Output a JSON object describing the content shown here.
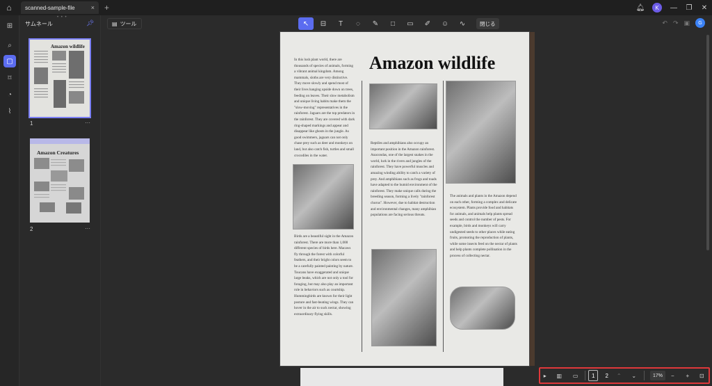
{
  "titlebar": {
    "tab_label": "scanned-sample-file",
    "tab_close": "×",
    "add_tab": "+",
    "avatar_letter": "K"
  },
  "thumbnails": {
    "header": "サムネール",
    "pages": [
      {
        "number": "1",
        "title": "Amazon wildlife",
        "more": "···"
      },
      {
        "number": "2",
        "title": "Amazon Creatures",
        "more": "···"
      }
    ]
  },
  "toolbar": {
    "tools_label": "ツール",
    "close_label": "閉じる",
    "badge": "G"
  },
  "page": {
    "title": "Amazon wildlife",
    "left_col_top": "In this lush plant world, there are thousands of species of animals, forming a vibrant animal kingdom. Among mammals, sloths are very distinctive. They move slowly and spend most of their lives hanging upside down on trees, feeding on leaves. Their slow metabolism and unique living habits make them the \"slow-moving\" representatives in the rainforest. Jaguars are the top predators in the rainforest. They are covered with dark ring-shaped markings and appear and disappear like ghosts in the jungle. As good swimmers, jaguars can not only chase prey such as deer and monkeys on land, but also catch fish, turtles and small crocodiles in the water.",
    "left_col_bottom": "Birds are a beautiful sight in the Amazon rainforest. There are more than 1,000 different species of birds here. Macaws fly through the forest with colorful feathers, and their bright colors seem to be a carefully painted painting by nature. Toucans have exaggerated and unique large beaks, which are not only a tool for foraging, but may also play an important role in behaviors such as courtship. Hummingbirds are known for their light posture and fast-beating wings. They can hover in the air to suck nectar, showing extraordinary flying skills.",
    "mid_col": "Reptiles and amphibians also occupy an important position in the Amazon rainforest. Anacondas, one of the largest snakes in the world, lurk in the rivers and jungles of the rainforest. They have powerful muscles and amazing winding ability to catch a variety of prey. And amphibians such as frogs and toads have adapted to the humid environment of the rainforest. They make unique calls during the breeding season, forming a lively \"rainforest chorus\". However, due to habitat destruction and environmental changes, many amphibian populations are facing serious threats.",
    "right_col": "The animals and plants in the Amazon depend on each other, forming a complex and delicate ecosystem. Plants provide food and habitats for animals, and animals help plants spread seeds and control the number of pests. For example, birds and monkeys will carry undigested seeds to other places while eating fruits, promoting the reproduction of plants, while some insects feed on the nectar of plants and help plants complete pollination in the process of collecting nectar."
  },
  "navigation": {
    "page_1": "1",
    "page_2": "2",
    "zoom": "17%",
    "zoom_out": "−",
    "zoom_in": "+"
  },
  "colors": {
    "accent": "#5b6cf0",
    "highlight_box": "#e0383b"
  }
}
